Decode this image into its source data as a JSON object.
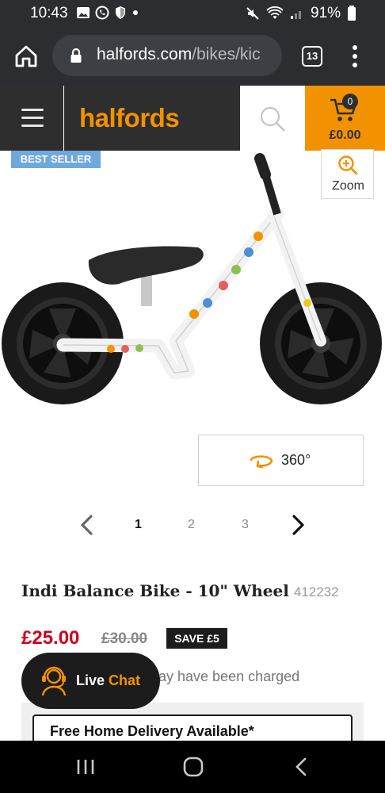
{
  "status_bar": {
    "time": "10:43",
    "battery": "91%"
  },
  "browser": {
    "url_main": "halfords.com",
    "url_path": "/bikes/kic",
    "tab_count": "13"
  },
  "header": {
    "logo": "halfords",
    "basket_count": "0",
    "basket_total": "£0.00"
  },
  "gallery": {
    "badge": "BEST SELLER",
    "zoom_label": "Zoom",
    "view_360_label": "360°",
    "pages": [
      "1",
      "2",
      "3"
    ],
    "active_page": "1"
  },
  "product": {
    "title": "Indi Balance Bike - 10\" Wheel",
    "code": "412232",
    "price_now": "£25.00",
    "price_was": "£30.00",
    "save_badge": "SAVE £5",
    "note_partial": "ay have been charged",
    "delivery_text": "Free Home Delivery Available*"
  },
  "live_chat": {
    "live": "Live",
    "chat": "Chat"
  },
  "colors": {
    "brand_orange": "#f39200",
    "dark": "#2e2e2e",
    "price_red": "#d0021b",
    "badge_blue": "#6fa8dc"
  }
}
